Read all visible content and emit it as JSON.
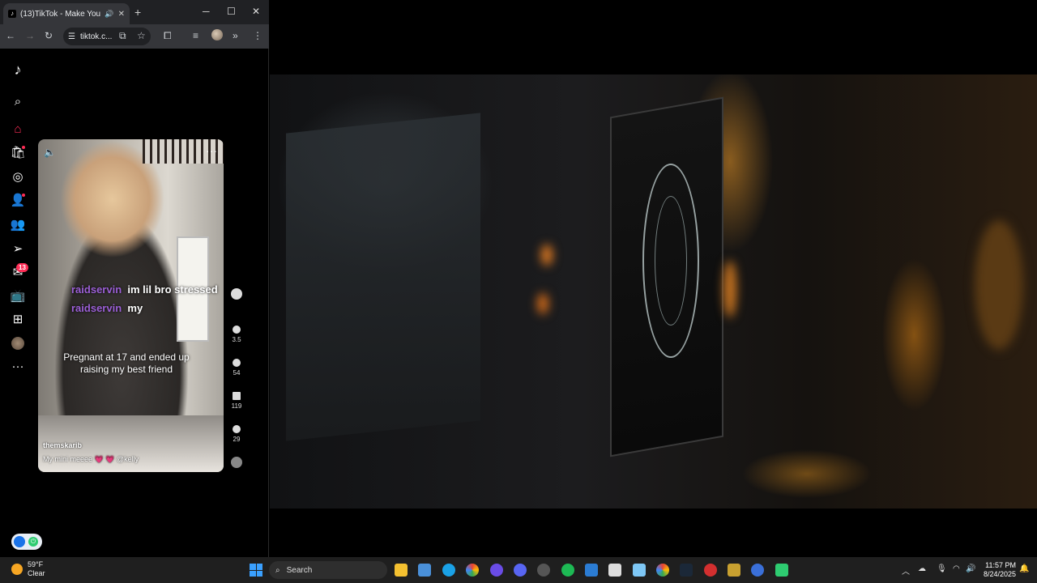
{
  "browser": {
    "tab_title": "(13)TikTok - Make Your Day",
    "url": "tiktok.c..."
  },
  "tiktok": {
    "inbox_badge": "13",
    "video": {
      "comments": [
        {
          "user": "raidservin",
          "text": "im lil bro stressed"
        },
        {
          "user": "raidservin",
          "text": "my"
        }
      ],
      "overlay_text": "Pregnant at 17 and ended up raising my best friend",
      "author": "themskarib",
      "description": "My mini meeee 💗 💗 @kelly"
    },
    "actions": [
      {
        "count": "3.5"
      },
      {
        "count": "54"
      },
      {
        "count": "119"
      },
      {
        "count": "29"
      }
    ]
  },
  "taskbar": {
    "weather_temp": "59°F",
    "weather_desc": "Clear",
    "search_label": "Search",
    "time": "11:57 PM",
    "date": "8/24/2025"
  },
  "colors": {
    "tiktok_accent": "#fe2c55",
    "comment_user": "#9b5fd6",
    "taskbar_bg": "#1f1f1f"
  }
}
